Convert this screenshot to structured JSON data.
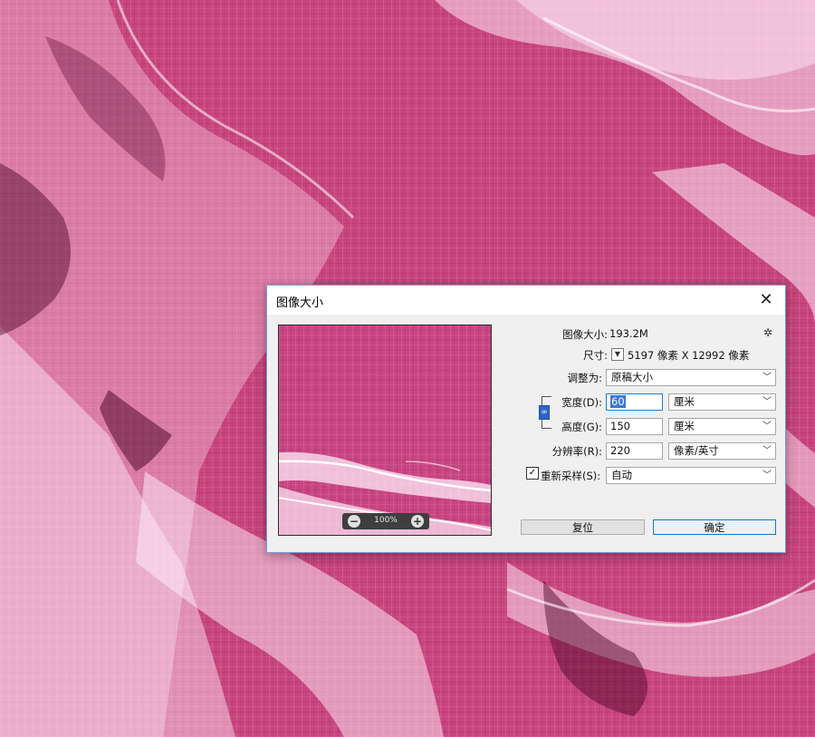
{
  "dialog": {
    "title": "图像大小",
    "close_glyph": "✕",
    "gear_glyph": "✲",
    "image_size_label": "图像大小:",
    "image_size_value": "193.2M",
    "dimensions_label": "尺寸:",
    "dimensions_value": "5197 像素  X  12992 像素",
    "fit_to_label": "调整为:",
    "fit_to_value": "原稿大小",
    "width_label": "宽度(D):",
    "width_value": "60",
    "width_unit": "厘米",
    "height_label": "高度(G):",
    "height_value": "150",
    "height_unit": "厘米",
    "resolution_label": "分辨率(R):",
    "resolution_value": "220",
    "resolution_unit": "像素/英寸",
    "resample_label": "重新采样(S):",
    "resample_checked_glyph": "✓",
    "resample_value": "自动",
    "zoom_value": "100%",
    "reset_button": "复位",
    "ok_button": "确定"
  },
  "icons": {
    "close": "close-icon",
    "gear": "gear-icon",
    "dropdown": "triangle-down-icon",
    "chain": "chain-link-icon",
    "zoom_out": "minus-circle-icon",
    "zoom_in": "plus-circle-icon"
  },
  "colors": {
    "canvas_pink": "#c8457f",
    "dialog_bg": "#f0f0f0",
    "accent_blue": "#1773c8",
    "selection_blue": "#3a78d3"
  }
}
